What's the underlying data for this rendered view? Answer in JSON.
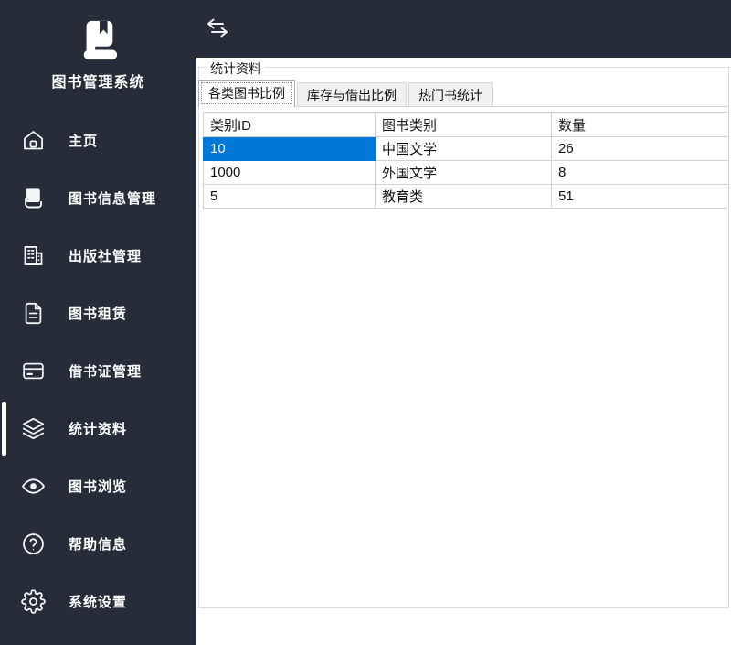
{
  "app": {
    "title": "图书管理系统"
  },
  "sidebar": {
    "items": [
      {
        "label": "主页",
        "icon": "home-icon"
      },
      {
        "label": "图书信息管理",
        "icon": "book-icon"
      },
      {
        "label": "出版社管理",
        "icon": "building-icon"
      },
      {
        "label": "图书租赁",
        "icon": "document-icon"
      },
      {
        "label": "借书证管理",
        "icon": "card-icon"
      },
      {
        "label": "统计资料",
        "icon": "layers-icon",
        "active": true
      },
      {
        "label": "图书浏览",
        "icon": "eye-icon"
      },
      {
        "label": "帮助信息",
        "icon": "help-icon"
      },
      {
        "label": "系统设置",
        "icon": "gear-icon"
      }
    ],
    "active_index": 5
  },
  "topbar": {
    "collapse_icon": "swap-arrows-icon"
  },
  "content": {
    "groupbox_title": "统计资料",
    "tabs": [
      {
        "label": "各类图书比例",
        "selected": true
      },
      {
        "label": "库存与借出比例",
        "selected": false
      },
      {
        "label": "热门书统计",
        "selected": false
      }
    ],
    "table": {
      "columns": [
        "类别ID",
        "图书类别",
        "数量"
      ],
      "rows": [
        [
          "10",
          "中国文学",
          "26"
        ],
        [
          "1000",
          "外国文学",
          "8"
        ],
        [
          "5",
          "教育类",
          "51"
        ]
      ],
      "selected_cell": {
        "row": 0,
        "col": 0
      }
    }
  },
  "colors": {
    "sidebar_bg": "#262d38",
    "selection_blue": "#0078d7",
    "selection_text": "#ffffff",
    "border_gray": "#d2d2d2"
  }
}
